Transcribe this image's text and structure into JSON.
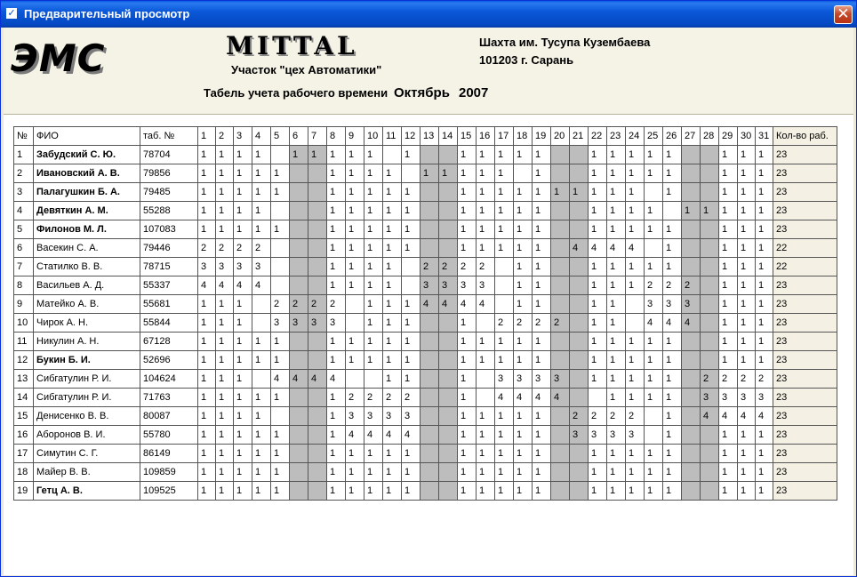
{
  "window": {
    "title": "Предварительный просмотр",
    "close_glyph": "✕"
  },
  "header": {
    "logo_text": "ЭМС",
    "company": "MITTAL",
    "section": "Участок \"цех Автоматики\"",
    "tabel_label": "Табель учета рабочего времени",
    "month": "Октябрь",
    "year": "2007",
    "mine": "Шахта им. Тусупа Кузембаева",
    "address": "101203 г. Сарань"
  },
  "table": {
    "headers": {
      "num": "№",
      "name": "ФИО",
      "tab": "таб. №",
      "total": "Кол-во раб."
    },
    "days": 31,
    "off_days": [
      6,
      7,
      13,
      14,
      20,
      21,
      27,
      28
    ],
    "off_color": "#bdbdbd",
    "rows": [
      {
        "n": "1",
        "name": "Забудский С. Ю.",
        "bold": true,
        "tab": "78704",
        "days": [
          "1",
          "1",
          "1",
          "1",
          "",
          "1",
          "1",
          "1",
          "1",
          "1",
          "",
          "1",
          "",
          "",
          "1",
          "1",
          "1",
          "1",
          "1",
          "",
          "",
          "1",
          "1",
          "1",
          "1",
          "1",
          "",
          "",
          "1",
          "1",
          "1"
        ],
        "total": "23"
      },
      {
        "n": "2",
        "name": "Ивановский А. В.",
        "bold": true,
        "tab": "79856",
        "days": [
          "1",
          "1",
          "1",
          "1",
          "1",
          "",
          "",
          "1",
          "1",
          "1",
          "1",
          "",
          "1",
          "1",
          "1",
          "1",
          "1",
          "",
          "1",
          "",
          "",
          "1",
          "1",
          "1",
          "1",
          "1",
          "",
          "",
          "1",
          "1",
          "1"
        ],
        "total": "23"
      },
      {
        "n": "3",
        "name": "Палагушкин Б. А.",
        "bold": true,
        "tab": "79485",
        "days": [
          "1",
          "1",
          "1",
          "1",
          "1",
          "",
          "",
          "1",
          "1",
          "1",
          "1",
          "1",
          "",
          "",
          "1",
          "1",
          "1",
          "1",
          "1",
          "1",
          "1",
          "1",
          "1",
          "1",
          "",
          "1",
          "",
          "",
          "1",
          "1",
          "1"
        ],
        "total": "23"
      },
      {
        "n": "4",
        "name": "Девяткин А. М.",
        "bold": true,
        "tab": "55288",
        "days": [
          "1",
          "1",
          "1",
          "1",
          "",
          "",
          "",
          "1",
          "1",
          "1",
          "1",
          "1",
          "",
          "",
          "1",
          "1",
          "1",
          "1",
          "1",
          "",
          "",
          "1",
          "1",
          "1",
          "1",
          "",
          "1",
          "1",
          "1",
          "1",
          "1"
        ],
        "total": "23"
      },
      {
        "n": "5",
        "name": "Филонов М. Л.",
        "bold": true,
        "tab": "107083",
        "days": [
          "1",
          "1",
          "1",
          "1",
          "1",
          "",
          "",
          "1",
          "1",
          "1",
          "1",
          "1",
          "",
          "",
          "1",
          "1",
          "1",
          "1",
          "1",
          "",
          "",
          "1",
          "1",
          "1",
          "1",
          "1",
          "",
          "",
          "1",
          "1",
          "1"
        ],
        "total": "23"
      },
      {
        "n": "6",
        "name": "Васекин С. А.",
        "bold": false,
        "tab": "79446",
        "days": [
          "2",
          "2",
          "2",
          "2",
          "",
          "",
          "",
          "1",
          "1",
          "1",
          "1",
          "1",
          "",
          "",
          "1",
          "1",
          "1",
          "1",
          "1",
          "",
          "4",
          "4",
          "4",
          "4",
          "",
          "1",
          "",
          "",
          "1",
          "1",
          "1"
        ],
        "total": "22"
      },
      {
        "n": "7",
        "name": "Статилко В. В.",
        "bold": false,
        "tab": "78715",
        "days": [
          "3",
          "3",
          "3",
          "3",
          "",
          "",
          "",
          "1",
          "1",
          "1",
          "1",
          "",
          "2",
          "2",
          "2",
          "2",
          "",
          "1",
          "1",
          "",
          "",
          "1",
          "1",
          "1",
          "1",
          "1",
          "",
          "",
          "1",
          "1",
          "1"
        ],
        "total": "22"
      },
      {
        "n": "8",
        "name": "Васильев А. Д.",
        "bold": false,
        "tab": "55337",
        "days": [
          "4",
          "4",
          "4",
          "4",
          "",
          "",
          "",
          "1",
          "1",
          "1",
          "1",
          "",
          "3",
          "3",
          "3",
          "3",
          "",
          "1",
          "1",
          "",
          "",
          "1",
          "1",
          "1",
          "2",
          "2",
          "2",
          "",
          "1",
          "1",
          "1"
        ],
        "total": "23"
      },
      {
        "n": "9",
        "name": "Матейко А. В.",
        "bold": false,
        "tab": "55681",
        "days": [
          "1",
          "1",
          "1",
          "",
          "2",
          "2",
          "2",
          "2",
          "",
          "1",
          "1",
          "1",
          "4",
          "4",
          "4",
          "4",
          "",
          "1",
          "1",
          "",
          "",
          "1",
          "1",
          "",
          "3",
          "3",
          "3",
          "",
          "1",
          "1",
          "1"
        ],
        "total": "23"
      },
      {
        "n": "10",
        "name": "Чирок А. Н.",
        "bold": false,
        "tab": "55844",
        "days": [
          "1",
          "1",
          "1",
          "",
          "3",
          "3",
          "3",
          "3",
          "",
          "1",
          "1",
          "1",
          "",
          "",
          "1",
          "",
          "2",
          "2",
          "2",
          "2",
          "",
          "1",
          "1",
          "",
          "4",
          "4",
          "4",
          "",
          "1",
          "1",
          "1"
        ],
        "total": "23"
      },
      {
        "n": "11",
        "name": "Никулин А. Н.",
        "bold": false,
        "tab": "67128",
        "days": [
          "1",
          "1",
          "1",
          "1",
          "1",
          "",
          "",
          "1",
          "1",
          "1",
          "1",
          "1",
          "",
          "",
          "1",
          "1",
          "1",
          "1",
          "1",
          "",
          "",
          "1",
          "1",
          "1",
          "1",
          "1",
          "",
          "",
          "1",
          "1",
          "1"
        ],
        "total": "23"
      },
      {
        "n": "12",
        "name": "Букин Б. И.",
        "bold": true,
        "tab": "52696",
        "days": [
          "1",
          "1",
          "1",
          "1",
          "1",
          "",
          "",
          "1",
          "1",
          "1",
          "1",
          "1",
          "",
          "",
          "1",
          "1",
          "1",
          "1",
          "1",
          "",
          "",
          "1",
          "1",
          "1",
          "1",
          "1",
          "",
          "",
          "1",
          "1",
          "1"
        ],
        "total": "23"
      },
      {
        "n": "13",
        "name": "Сибгатулин Р. И.",
        "bold": false,
        "tab": "104624",
        "days": [
          "1",
          "1",
          "1",
          "",
          "4",
          "4",
          "4",
          "4",
          "",
          "",
          "1",
          "1",
          "",
          "",
          "1",
          "",
          "3",
          "3",
          "3",
          "3",
          "",
          "1",
          "1",
          "1",
          "1",
          "1",
          "",
          "2",
          "2",
          "2",
          "2"
        ],
        "total": "23"
      },
      {
        "n": "14",
        "name": "Сибгатулин Р. И.",
        "bold": false,
        "tab": "71763",
        "days": [
          "1",
          "1",
          "1",
          "1",
          "1",
          "",
          "",
          "1",
          "2",
          "2",
          "2",
          "2",
          "",
          "",
          "1",
          "",
          "4",
          "4",
          "4",
          "4",
          "",
          "",
          "1",
          "1",
          "1",
          "1",
          "",
          "3",
          "3",
          "3",
          "3"
        ],
        "total": "23"
      },
      {
        "n": "15",
        "name": "Денисенко В. В.",
        "bold": false,
        "tab": "80087",
        "days": [
          "1",
          "1",
          "1",
          "1",
          "",
          "",
          "",
          "1",
          "3",
          "3",
          "3",
          "3",
          "",
          "",
          "1",
          "1",
          "1",
          "1",
          "1",
          "",
          "2",
          "2",
          "2",
          "2",
          "",
          "1",
          "",
          "4",
          "4",
          "4",
          "4"
        ],
        "total": "23"
      },
      {
        "n": "16",
        "name": "Аборонов В. И.",
        "bold": false,
        "tab": "55780",
        "days": [
          "1",
          "1",
          "1",
          "1",
          "1",
          "",
          "",
          "1",
          "4",
          "4",
          "4",
          "4",
          "",
          "",
          "1",
          "1",
          "1",
          "1",
          "1",
          "",
          "3",
          "3",
          "3",
          "3",
          "",
          "1",
          "",
          "",
          "1",
          "1",
          "1"
        ],
        "total": "23"
      },
      {
        "n": "17",
        "name": "Симутин С. Г.",
        "bold": false,
        "tab": "86149",
        "days": [
          "1",
          "1",
          "1",
          "1",
          "1",
          "",
          "",
          "1",
          "1",
          "1",
          "1",
          "1",
          "",
          "",
          "1",
          "1",
          "1",
          "1",
          "1",
          "",
          "",
          "1",
          "1",
          "1",
          "1",
          "1",
          "",
          "",
          "1",
          "1",
          "1"
        ],
        "total": "23"
      },
      {
        "n": "18",
        "name": "Майер В. В.",
        "bold": false,
        "tab": "109859",
        "days": [
          "1",
          "1",
          "1",
          "1",
          "1",
          "",
          "",
          "1",
          "1",
          "1",
          "1",
          "1",
          "",
          "",
          "1",
          "1",
          "1",
          "1",
          "1",
          "",
          "",
          "1",
          "1",
          "1",
          "1",
          "1",
          "",
          "",
          "1",
          "1",
          "1"
        ],
        "total": "23"
      },
      {
        "n": "19",
        "name": "Гетц А. В.",
        "bold": true,
        "tab": "109525",
        "days": [
          "1",
          "1",
          "1",
          "1",
          "1",
          "",
          "",
          "1",
          "1",
          "1",
          "1",
          "1",
          "",
          "",
          "1",
          "1",
          "1",
          "1",
          "1",
          "",
          "",
          "1",
          "1",
          "1",
          "1",
          "1",
          "",
          "",
          "1",
          "1",
          "1"
        ],
        "total": "23"
      }
    ]
  }
}
